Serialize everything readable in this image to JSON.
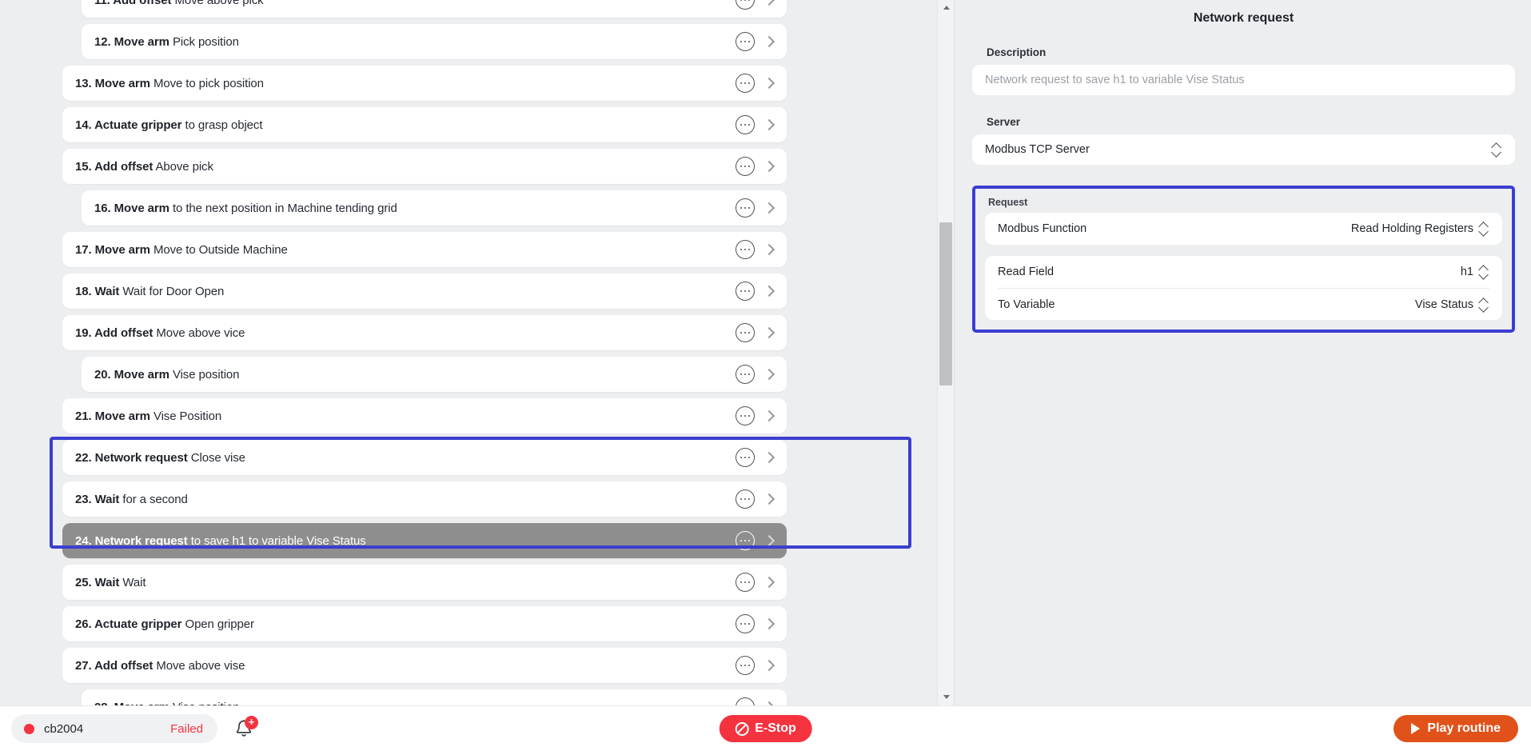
{
  "steps": [
    {
      "index": "11.",
      "action": "Add offset",
      "desc": "Move above pick",
      "indent": true,
      "selected": false,
      "partial": "top"
    },
    {
      "index": "12.",
      "action": "Move arm",
      "desc": "Pick position",
      "indent": true,
      "selected": false
    },
    {
      "index": "13.",
      "action": "Move arm",
      "desc": "Move to pick position",
      "indent": false,
      "selected": false
    },
    {
      "index": "14.",
      "action": "Actuate gripper",
      "desc": "to grasp object",
      "indent": false,
      "selected": false
    },
    {
      "index": "15.",
      "action": "Add offset",
      "desc": "Above pick",
      "indent": false,
      "selected": false
    },
    {
      "index": "16.",
      "action": "Move arm",
      "desc": "to the next position in Machine tending grid",
      "indent": true,
      "selected": false
    },
    {
      "index": "17.",
      "action": "Move arm",
      "desc": "Move to Outside Machine",
      "indent": false,
      "selected": false
    },
    {
      "index": "18.",
      "action": "Wait",
      "desc": "Wait for Door Open",
      "indent": false,
      "selected": false
    },
    {
      "index": "19.",
      "action": "Add offset",
      "desc": "Move above vice",
      "indent": false,
      "selected": false
    },
    {
      "index": "20.",
      "action": "Move arm",
      "desc": "Vise position",
      "indent": true,
      "selected": false
    },
    {
      "index": "21.",
      "action": "Move arm",
      "desc": "Vise Position",
      "indent": false,
      "selected": false
    },
    {
      "index": "22.",
      "action": "Network request",
      "desc": "Close vise",
      "indent": false,
      "selected": false
    },
    {
      "index": "23.",
      "action": "Wait",
      "desc": "for a second",
      "indent": false,
      "selected": false
    },
    {
      "index": "24.",
      "action": "Network request",
      "desc": "to save h1 to variable Vise Status",
      "indent": false,
      "selected": true
    },
    {
      "index": "25.",
      "action": "Wait",
      "desc": "Wait",
      "indent": false,
      "selected": false
    },
    {
      "index": "26.",
      "action": "Actuate gripper",
      "desc": "Open gripper",
      "indent": false,
      "selected": false
    },
    {
      "index": "27.",
      "action": "Add offset",
      "desc": "Move above vise",
      "indent": false,
      "selected": false
    },
    {
      "index": "28.",
      "action": "Move arm",
      "desc": "Vise position",
      "indent": true,
      "selected": false,
      "partial": "bottom"
    }
  ],
  "row_icons": {
    "menu": "more-options-icon",
    "expand": "chevron-right-icon"
  },
  "panel": {
    "title": "Network request",
    "description": {
      "label": "Description",
      "value": "",
      "placeholder": "Network request to save h1 to variable Vise Status"
    },
    "server": {
      "label": "Server",
      "value": "Modbus TCP Server"
    },
    "request": {
      "label": "Request",
      "rows": [
        {
          "key": "Modbus Function",
          "value": "Read Holding Registers"
        },
        {
          "key": "Read Field",
          "value": "h1"
        },
        {
          "key": "To Variable",
          "value": "Vise Status"
        }
      ]
    }
  },
  "bottom_bar": {
    "robot_name": "cb2004",
    "robot_state": "Failed",
    "notification_badge": "+",
    "estop_label": "E-Stop",
    "play_label": "Play routine"
  },
  "colors": {
    "selection_outline": "#3b3ed0",
    "selected_row": "#8e8e8e",
    "danger": "#f5333f",
    "play": "#e0521a",
    "background": "#eceef0",
    "card": "#ffffff"
  }
}
